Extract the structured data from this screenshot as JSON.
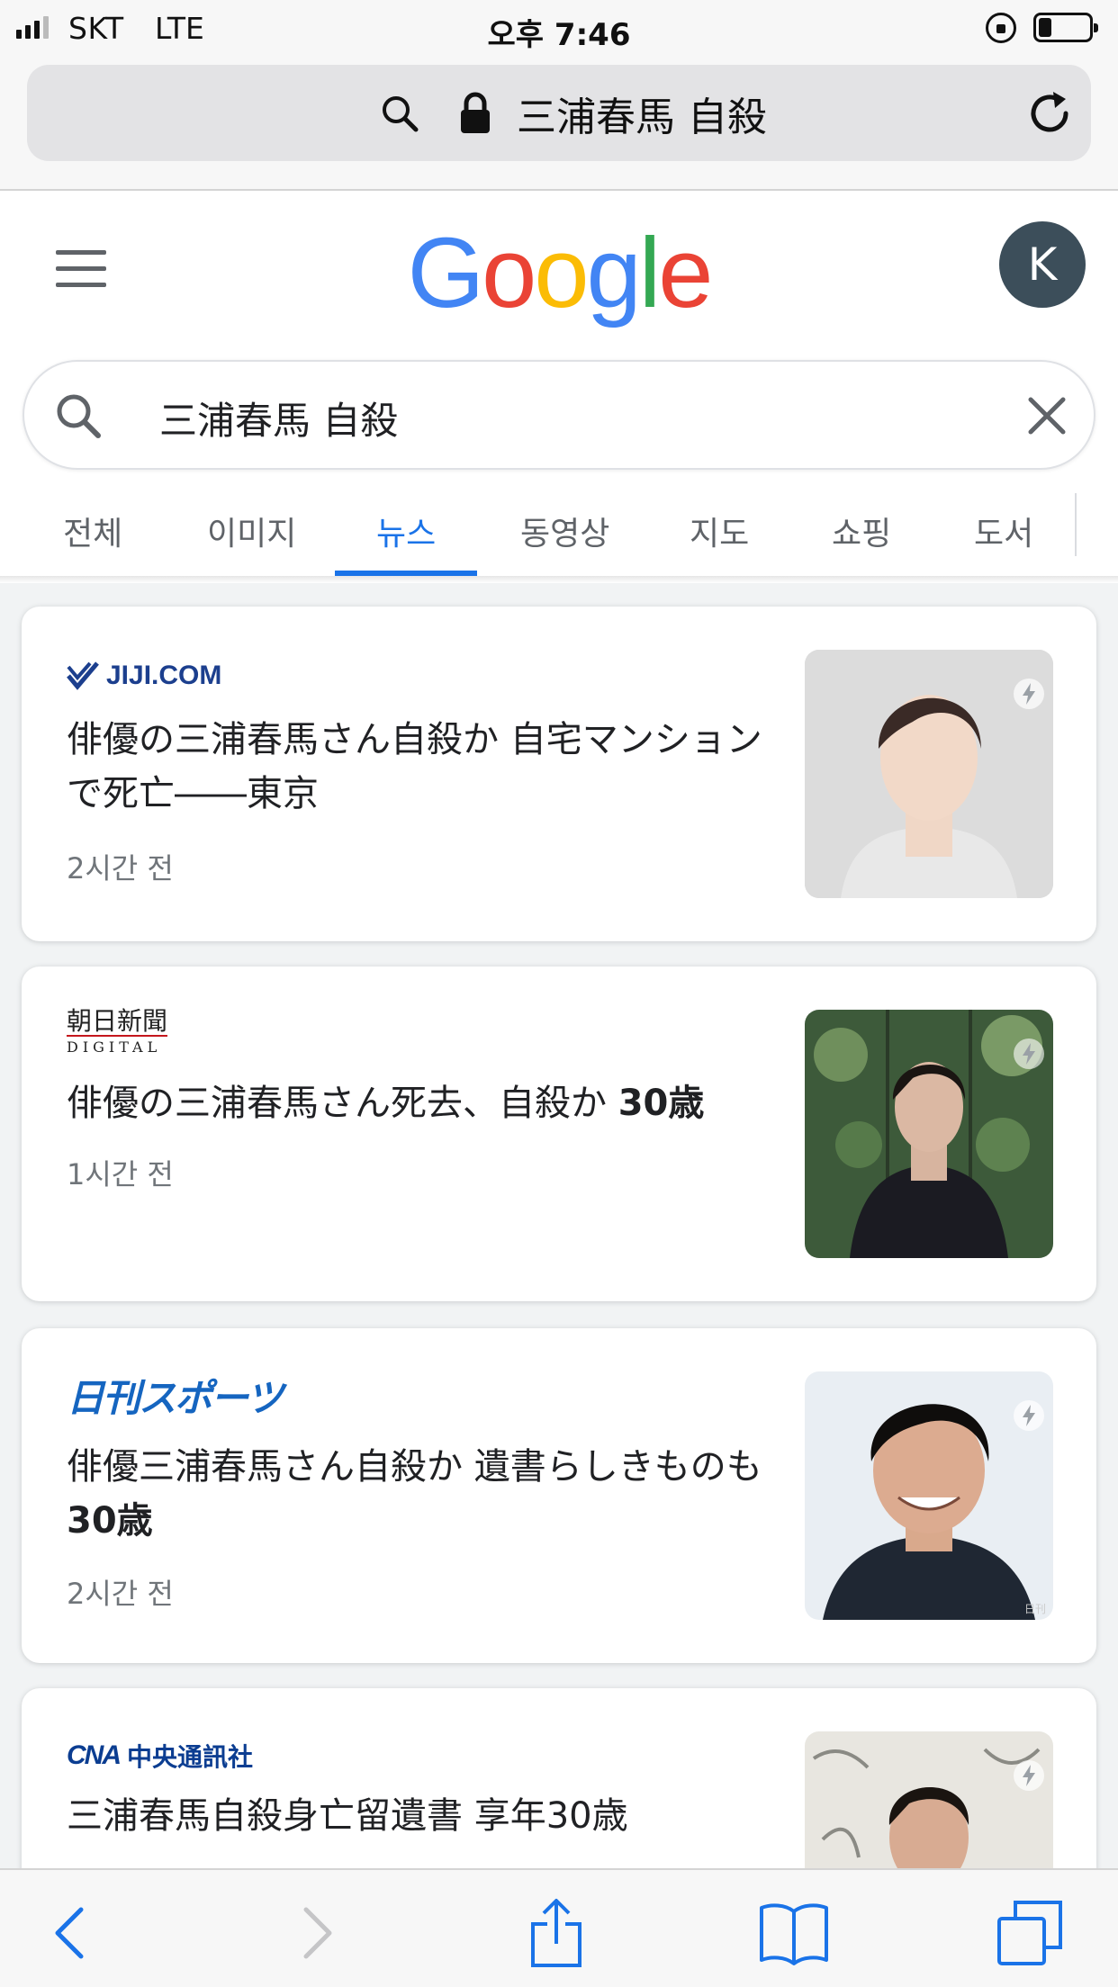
{
  "status_bar": {
    "carrier": "SKT",
    "network": "LTE",
    "time": "오후 7:46",
    "battery_level": 0.25
  },
  "address_bar": {
    "query": "三浦春馬 自殺"
  },
  "google": {
    "logo_letters": [
      {
        "ch": "G",
        "color": "#4285F4"
      },
      {
        "ch": "o",
        "color": "#EA4335"
      },
      {
        "ch": "o",
        "color": "#FBBC05"
      },
      {
        "ch": "g",
        "color": "#4285F4"
      },
      {
        "ch": "l",
        "color": "#34A853"
      },
      {
        "ch": "e",
        "color": "#EA4335"
      }
    ],
    "avatar_initial": "K"
  },
  "search": {
    "value": "三浦春馬 自殺"
  },
  "tabs": [
    {
      "label": "전체",
      "active": false
    },
    {
      "label": "이미지",
      "active": false
    },
    {
      "label": "뉴스",
      "active": true
    },
    {
      "label": "동영상",
      "active": false
    },
    {
      "label": "지도",
      "active": false
    },
    {
      "label": "쇼핑",
      "active": false
    },
    {
      "label": "도서",
      "active": false
    }
  ],
  "news": [
    {
      "source": "JIJI.COM",
      "title": "俳優の三浦春馬さん自殺か 自宅マンションで死亡――東京",
      "age": "2시간 전"
    },
    {
      "source": "朝日新聞",
      "source_sub": "DIGITAL",
      "title_main": "俳優の三浦春馬さん死去、自殺か ",
      "title_bold": "30歳",
      "age": "1시간 전"
    },
    {
      "source": "日刊スポーツ",
      "title_main": "俳優三浦春馬さん自殺か 遺書らしきものも ",
      "title_bold": "30歳",
      "age": "2시간 전",
      "thumb_caption": "日刊"
    },
    {
      "source": "中央通訊社",
      "source_logo": "CNA",
      "title": "三浦春馬自殺身亡留遺書 享年30歳"
    }
  ],
  "colors": {
    "accent": "#1a73e8",
    "jiji_blue": "#1c3f8e",
    "nikkan_blue": "#1565c0",
    "cna_blue": "#0b3d91",
    "asahi_red": "#c4161c"
  }
}
